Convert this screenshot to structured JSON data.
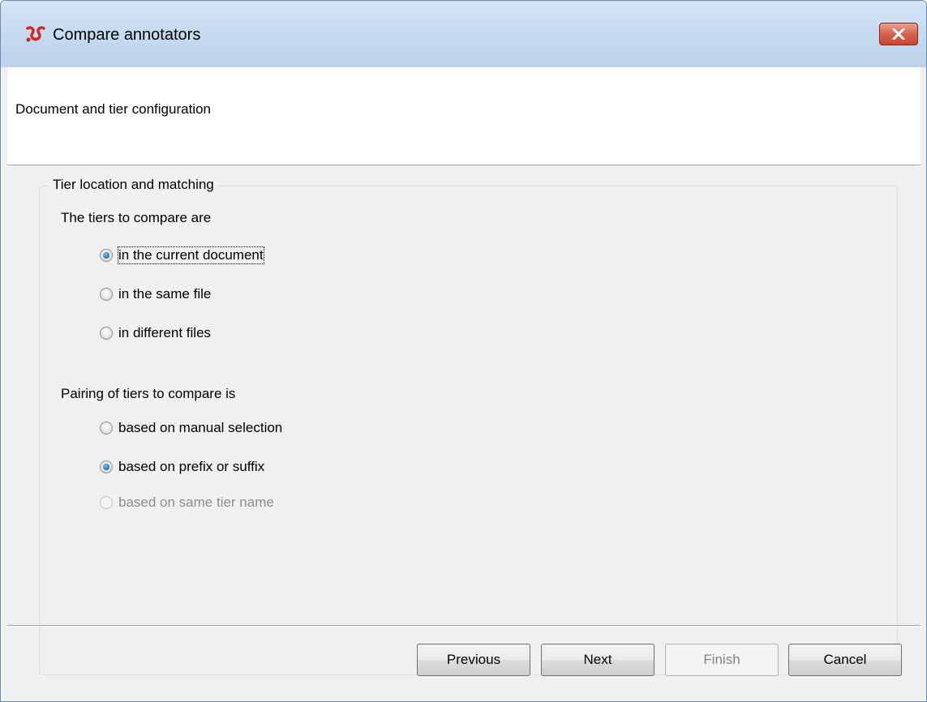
{
  "window": {
    "title": "Compare annotators",
    "app_icon": "elan-logo-icon",
    "close_icon": "close-icon"
  },
  "header": {
    "title": "Document and tier configuration"
  },
  "group": {
    "legend": "Tier location and matching",
    "location": {
      "label": "The tiers to compare are",
      "options": [
        {
          "label": "in the current document",
          "checked": true,
          "enabled": true
        },
        {
          "label": "in the same file",
          "checked": false,
          "enabled": true
        },
        {
          "label": "in different files",
          "checked": false,
          "enabled": true
        }
      ]
    },
    "pairing": {
      "label": "Pairing of tiers to compare is",
      "options": [
        {
          "label": "based on manual selection",
          "checked": false,
          "enabled": true
        },
        {
          "label": "based on prefix or suffix",
          "checked": true,
          "enabled": true
        },
        {
          "label": "based on same tier name",
          "checked": false,
          "enabled": false
        }
      ]
    }
  },
  "buttons": {
    "previous": "Previous",
    "next": "Next",
    "finish": "Finish",
    "cancel": "Cancel"
  },
  "colors": {
    "titlebar": "#c6daf0",
    "close_button": "#d7614b",
    "radio_selected": "#1c6fb6",
    "disabled_text": "#8d8d8d"
  }
}
